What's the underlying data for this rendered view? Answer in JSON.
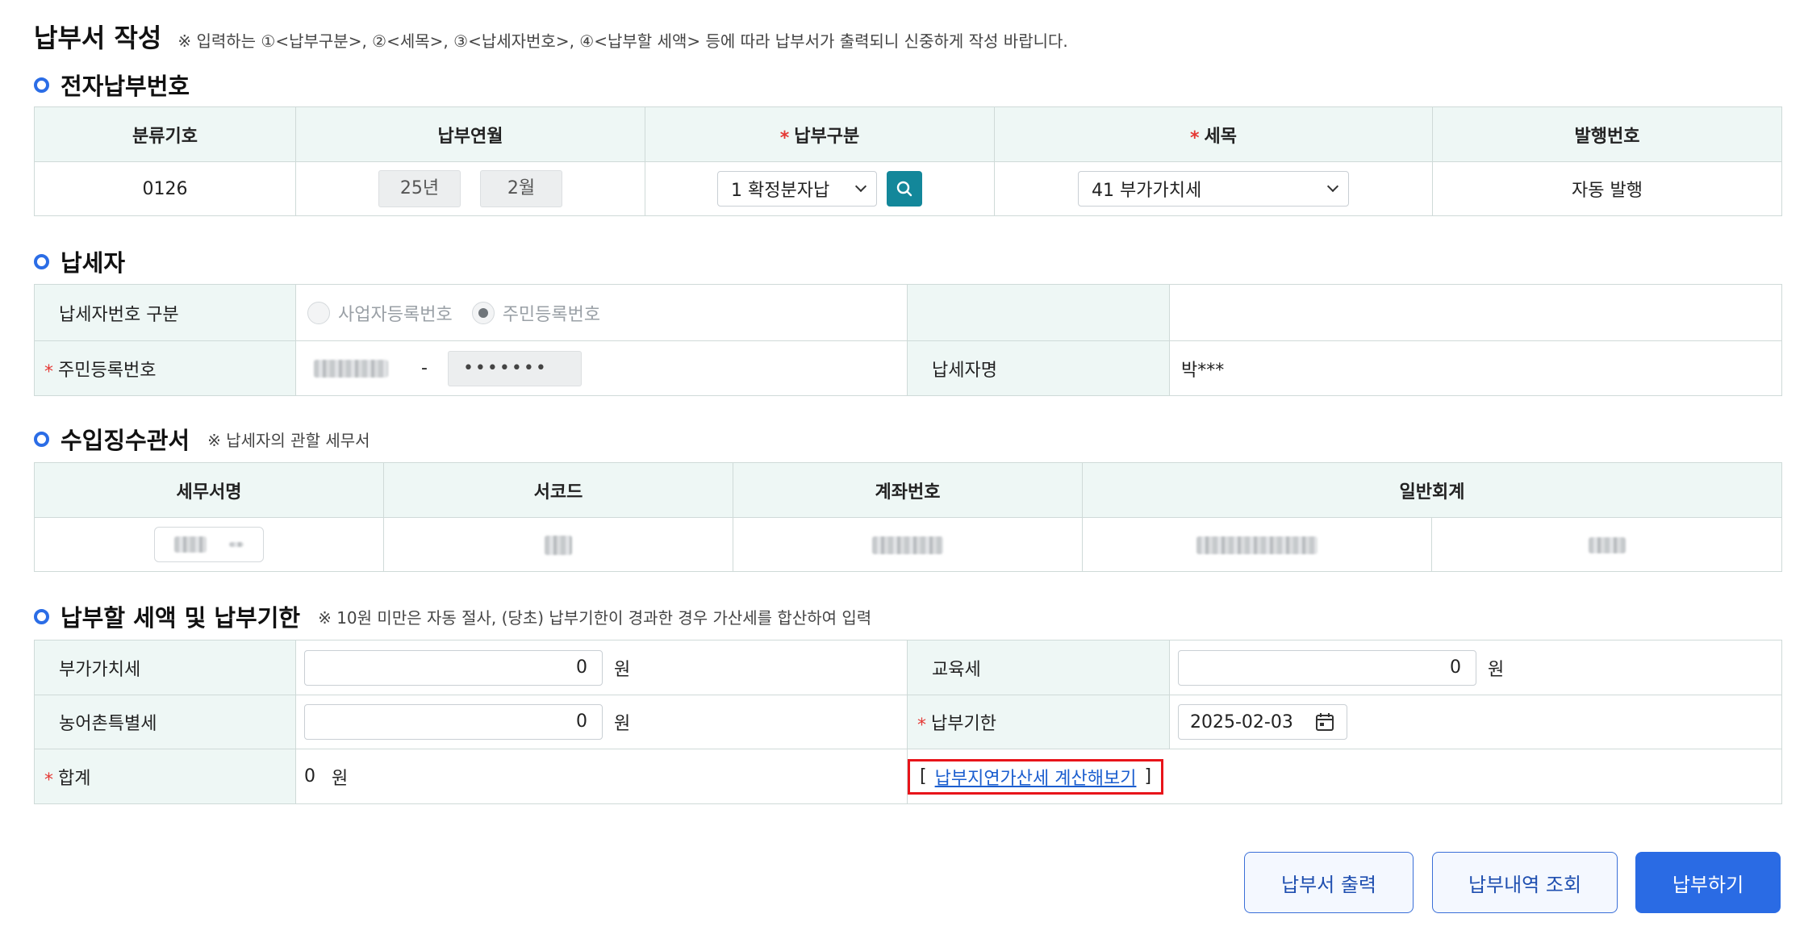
{
  "header": {
    "title": "납부서 작성",
    "note": "※ 입력하는 ①<납부구분>, ②<세목>, ③<납세자번호>, ④<납부할 세액> 등에 따라 납부서가 출력되니 신중하게 작성 바랍니다."
  },
  "electronic": {
    "section_title": "전자납부번호",
    "columns": [
      "분류기호",
      "납부연월",
      "납부구분",
      "세목",
      "발행번호"
    ],
    "classification_code": "0126",
    "year": "25년",
    "month": "2월",
    "payment_type": "1 확정분자납",
    "tax_item": "41 부가가치세",
    "issue_number": "자동 발행"
  },
  "taxpayer": {
    "section_title": "납세자",
    "id_type_label": "납세자번호 구분",
    "radio_business": "사업자등록번호",
    "radio_resident": "주민등록번호",
    "resident_label": "주민등록번호",
    "resident_dash": "-",
    "resident_masked": "•••••••",
    "name_label": "납세자명",
    "name_value": "박***"
  },
  "office": {
    "section_title": "수입징수관서",
    "note": "※ 납세자의 관할 세무서",
    "columns": [
      "세무서명",
      "서코드",
      "계좌번호",
      "일반회계"
    ]
  },
  "amounts": {
    "section_title": "납부할 세액 및 납부기한",
    "note": "※ 10원 미만은 자동 절사, (당초) 납부기한이 경과한 경우 가산세를 합산하여 입력",
    "vat_label": "부가가치세",
    "vat_value": "0",
    "edu_label": "교육세",
    "edu_value": "0",
    "rural_label": "농어촌특별세",
    "rural_value": "0",
    "deadline_label": "납부기한",
    "deadline_value": "2025-02-03",
    "total_label": "합계",
    "total_value": "0",
    "unit": "원",
    "calc_open": "[",
    "calc_link": "납부지연가산세 계산해보기",
    "calc_close": "]"
  },
  "buttons": {
    "print": "납부서 출력",
    "history": "납부내역 조회",
    "pay": "납부하기"
  },
  "colors": {
    "accent": "#2a6be4",
    "search_button": "#13879a",
    "header_bg": "#eef7f5",
    "required": "#e53935",
    "highlight_border": "#e8141a"
  }
}
